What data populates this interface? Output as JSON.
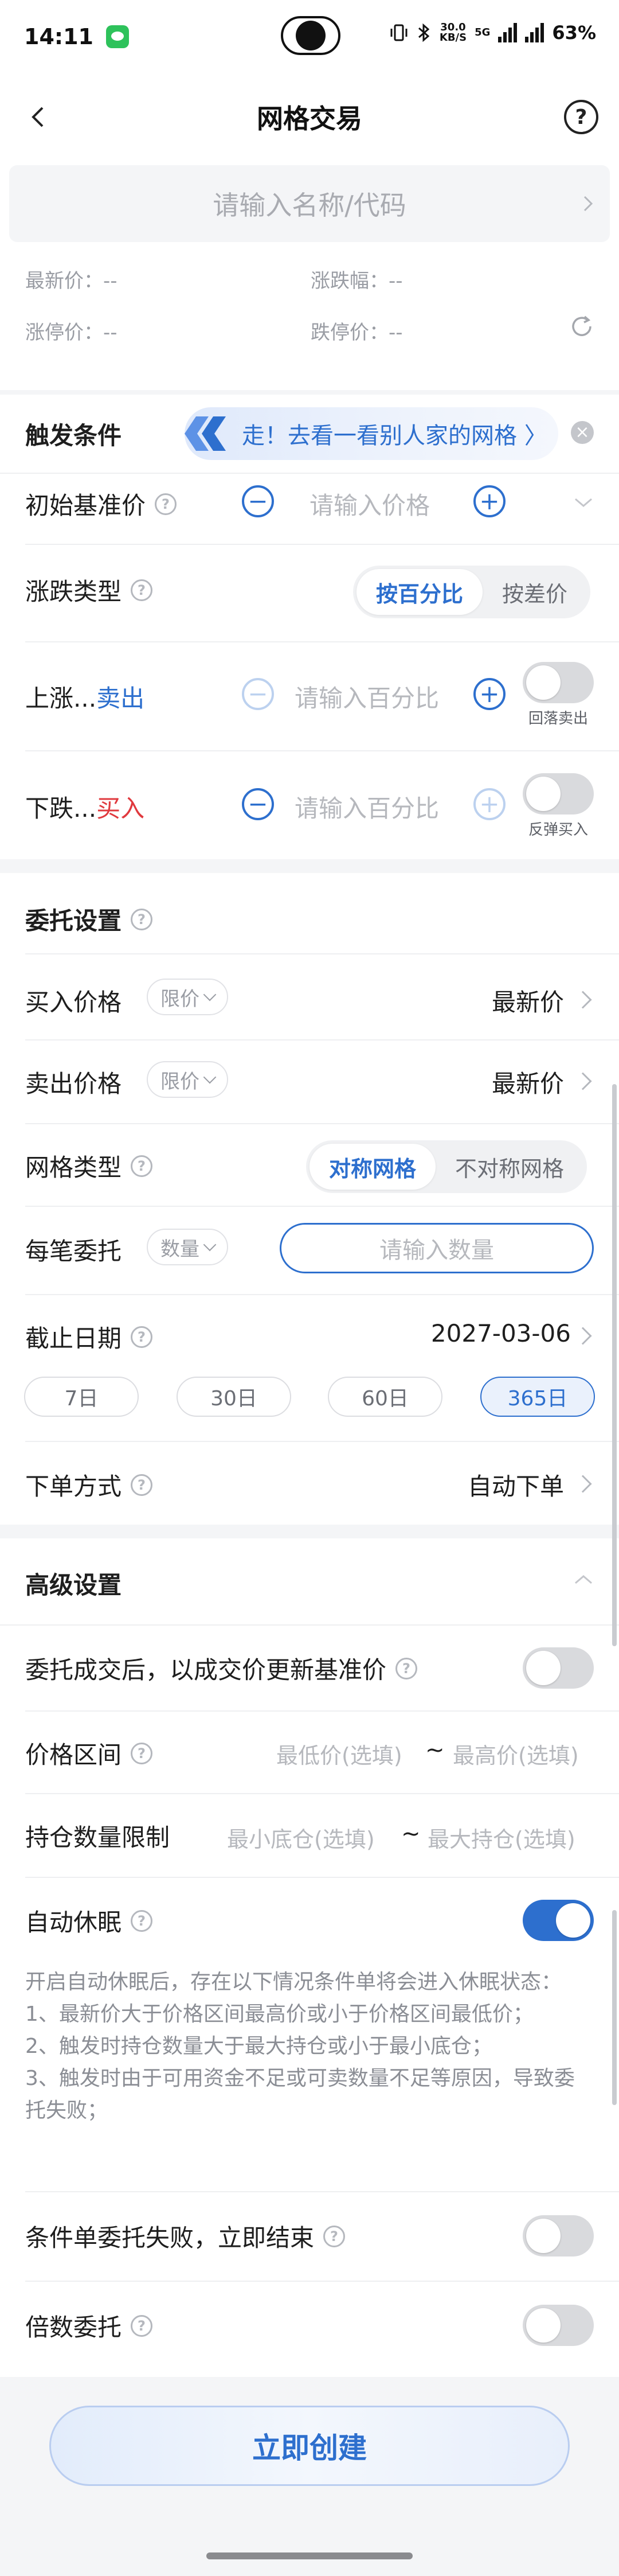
{
  "status_bar": {
    "time": "14:11",
    "net_speed_top": "30.0",
    "net_speed_bottom": "KB/S",
    "signal_label": "5G",
    "battery": "63%"
  },
  "nav": {
    "title": "网格交易"
  },
  "stock": {
    "placeholder": "请输入名称/代码",
    "latest_label": "最新价：--",
    "change_label": "涨跌幅：--",
    "limit_up_label": "涨停价：--",
    "limit_down_label": "跌停价：--"
  },
  "trigger": {
    "title": "触发条件",
    "banner_text": "走！去看一看别人家的网格 〉",
    "base_price_label": "初始基准价",
    "base_price_placeholder": "请输入价格",
    "change_type_label": "涨跌类型",
    "change_type_options": [
      "按百分比",
      "按差价"
    ],
    "rise_label_prefix": "上涨...",
    "rise_label_action": "卖出",
    "rise_placeholder": "请输入百分比",
    "rise_toggle_caption": "回落卖出",
    "fall_label_prefix": "下跌...",
    "fall_label_action": "买入",
    "fall_placeholder": "请输入百分比",
    "fall_toggle_caption": "反弹买入",
    "colors": {
      "sell": "#2d6fce",
      "buy": "#e0393e"
    }
  },
  "order": {
    "title": "委托设置",
    "buy_price_label": "买入价格",
    "buy_price_type": "限价",
    "buy_price_value": "最新价",
    "sell_price_label": "卖出价格",
    "sell_price_type": "限价",
    "sell_price_value": "最新价",
    "grid_type_label": "网格类型",
    "grid_type_options": [
      "对称网格",
      "不对称网格"
    ],
    "per_order_label": "每笔委托",
    "per_order_type": "数量",
    "per_order_placeholder": "请输入数量",
    "deadline_label": "截止日期",
    "deadline_value": "2027-03-06",
    "deadline_chips": [
      "7日",
      "30日",
      "60日",
      "365日"
    ],
    "method_label": "下单方式",
    "method_value": "自动下单"
  },
  "advanced": {
    "title": "高级设置",
    "update_base_label": "委托成交后，以成交价更新基准价",
    "price_range_label": "价格区间",
    "price_min_placeholder": "最低价(选填)",
    "price_max_placeholder": "最高价(选填)",
    "range_sep": "~",
    "position_limit_label": "持仓数量限制",
    "position_min_placeholder": "最小底仓(选填)",
    "position_max_placeholder": "最大持仓(选填)",
    "auto_sleep_label": "自动休眠",
    "auto_sleep_desc_1": "开启自动休眠后，存在以下情况条件单将会进入休眠状态：",
    "auto_sleep_desc_2": "1、最新价大于价格区间最高价或小于价格区间最低价；",
    "auto_sleep_desc_3": "2、触发时持仓数量大于最大持仓或小于最小底仓；",
    "auto_sleep_desc_4": "3、触发时由于可用资金不足或可卖数量不足等原因，导致委托失败；",
    "fail_end_label": "条件单委托失败，立即结束",
    "multiple_label": "倍数委托"
  },
  "footer": {
    "create_label": "立即创建"
  }
}
